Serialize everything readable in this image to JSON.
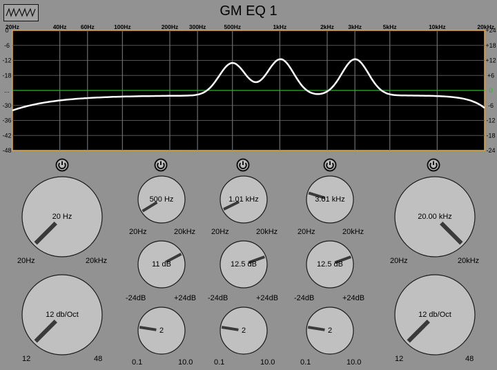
{
  "title": "GM EQ 1",
  "logo_icon": "waveform-icon",
  "graph": {
    "freq_labels": [
      "20Hz",
      "40Hz",
      "60Hz",
      "100Hz",
      "200Hz",
      "300Hz",
      "500Hz",
      "1kHz",
      "2kHz",
      "3kHz",
      "5kHz",
      "10kHz",
      "20kHz"
    ],
    "freq_values": [
      20,
      40,
      60,
      100,
      200,
      300,
      500,
      1000,
      2000,
      3000,
      5000,
      10000,
      20000
    ],
    "left_db_labels": [
      "0",
      "-6",
      "-12",
      "-18",
      "...",
      "-30",
      "-36",
      "-42",
      "-48"
    ],
    "right_db_labels": [
      "+24",
      "+18",
      "+12",
      "+6",
      "0",
      "-6",
      "-12",
      "-18",
      "-24"
    ],
    "right_db_range": [
      24,
      -24
    ],
    "curve_color": "#ffffff",
    "zero_line_color": "#2db52d",
    "border_color": "#e8a23a",
    "curve": {
      "baseline_db": -2,
      "peaks": [
        {
          "freq_hz": 500,
          "gain_db": 11
        },
        {
          "freq_hz": 1010,
          "gain_db": 12.5
        },
        {
          "freq_hz": 3010,
          "gain_db": 12.5
        }
      ]
    }
  },
  "bands": {
    "lowcut": {
      "power_icon": "power-icon",
      "freq": {
        "value": "20 Hz",
        "min": "20Hz",
        "max": "20kHz",
        "pos": 0.0
      },
      "slope": {
        "value": "12 db/Oct",
        "min": "12",
        "max": "48",
        "pos": 0.0
      }
    },
    "peak1": {
      "power_icon": "power-icon",
      "freq": {
        "value": "500 Hz",
        "min": "20Hz",
        "max": "20kHz",
        "pos": 0.05
      },
      "gain": {
        "value": "11 dB",
        "min": "-24dB",
        "max": "+24dB",
        "pos": 0.73
      },
      "q": {
        "value": "2",
        "min": "0.1",
        "max": "10.0",
        "pos": 0.2
      }
    },
    "peak2": {
      "power_icon": "power-icon",
      "freq": {
        "value": "1.01 kHz",
        "min": "20Hz",
        "max": "20kHz",
        "pos": 0.07
      },
      "gain": {
        "value": "12.5 dB",
        "min": "-24dB",
        "max": "+24dB",
        "pos": 0.76
      },
      "q": {
        "value": "2",
        "min": "0.1",
        "max": "10.0",
        "pos": 0.2
      }
    },
    "peak3": {
      "power_icon": "power-icon",
      "freq": {
        "value": "3.01 kHz",
        "min": "20Hz",
        "max": "20kHz",
        "pos": 0.23
      },
      "gain": {
        "value": "12.5 dB",
        "min": "-24dB",
        "max": "+24dB",
        "pos": 0.76
      },
      "q": {
        "value": "2",
        "min": "0.1",
        "max": "10.0",
        "pos": 0.2
      }
    },
    "highcut": {
      "power_icon": "power-icon",
      "freq": {
        "value": "20.00 kHz",
        "min": "20Hz",
        "max": "20kHz",
        "pos": 1.0
      },
      "slope": {
        "value": "12 db/Oct",
        "min": "12",
        "max": "48",
        "pos": 0.0
      }
    }
  }
}
